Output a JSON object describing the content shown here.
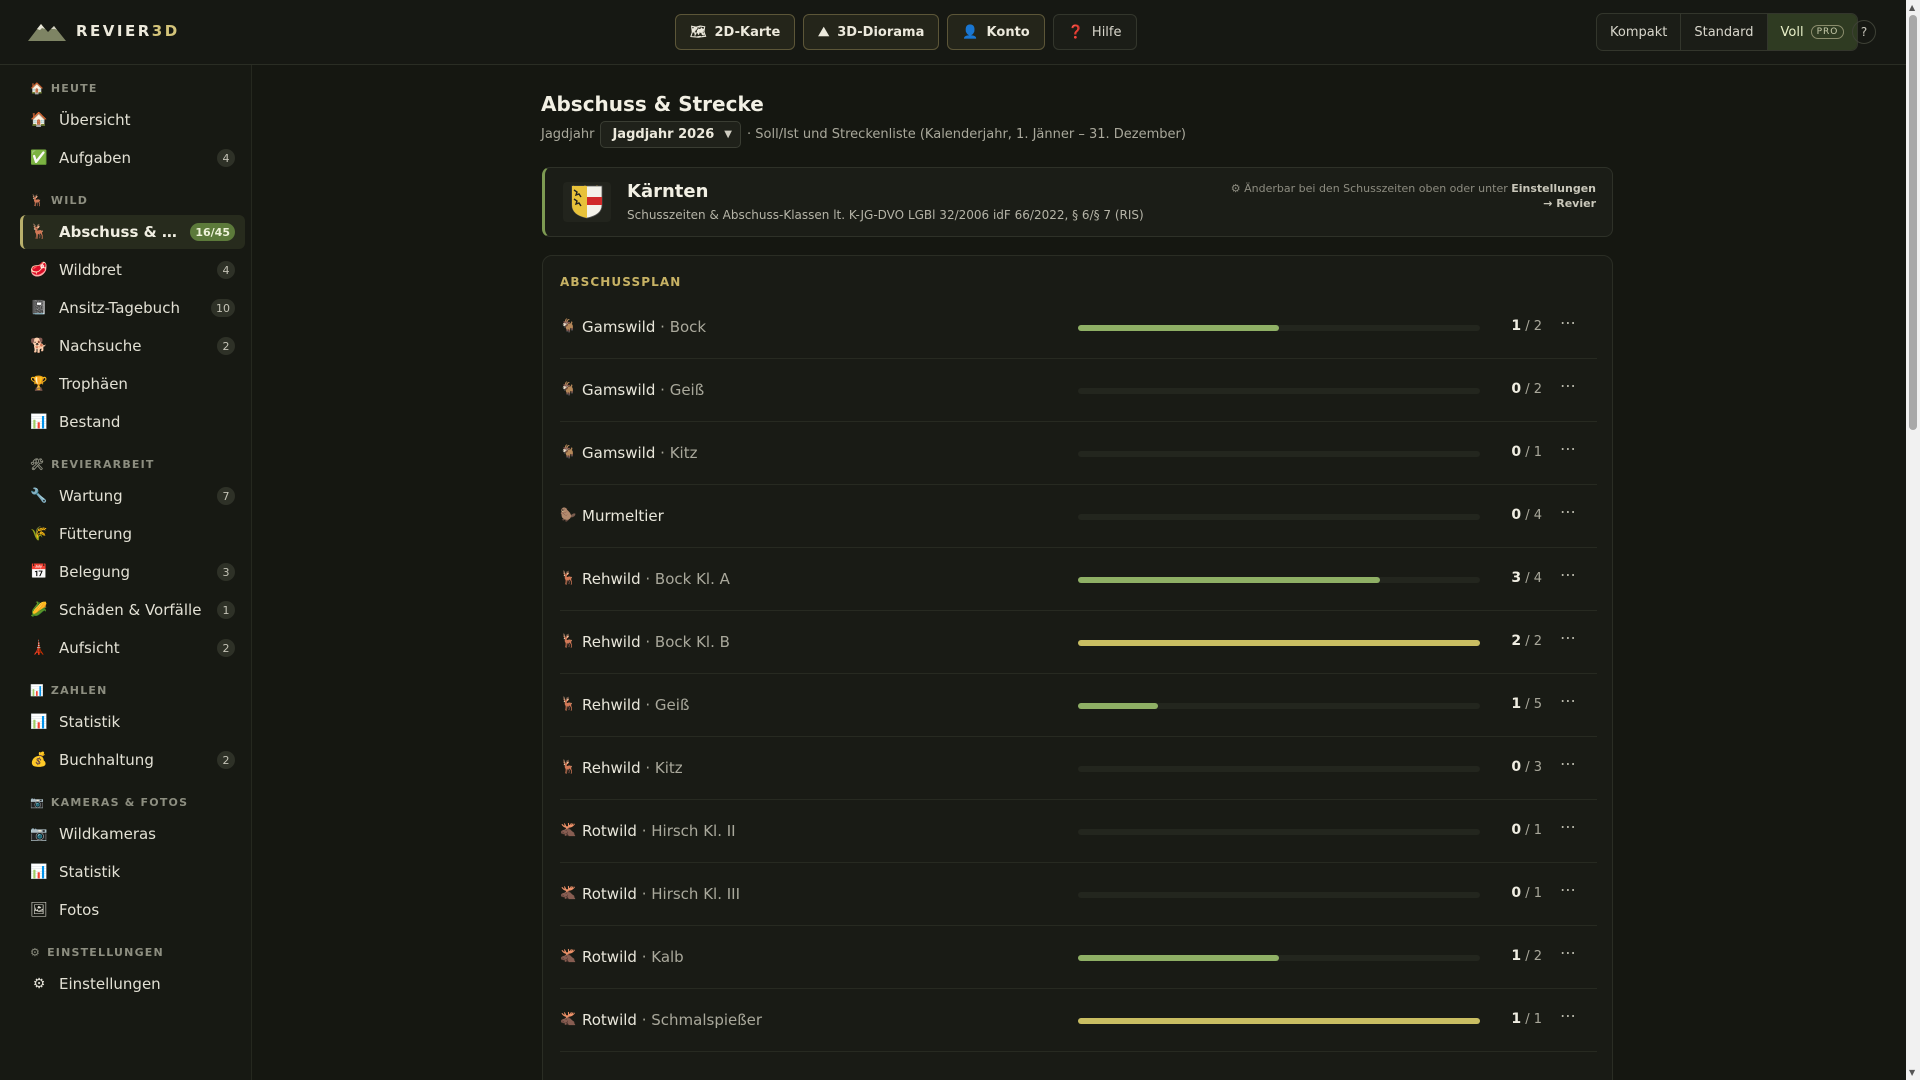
{
  "app": {
    "logo_text": "REVIER",
    "logo_accent": "3D"
  },
  "topnav": [
    {
      "label": "2D-Karte",
      "icon": "map-icon",
      "glyph": "🗺"
    },
    {
      "label": "3D-Diorama",
      "icon": "mountain-icon",
      "glyph": "⛰"
    },
    {
      "label": "Konto",
      "icon": "user-icon",
      "glyph": "👤"
    },
    {
      "label": "Hilfe",
      "icon": "question-icon",
      "glyph": "❓"
    }
  ],
  "view_modes": {
    "compact": "Kompakt",
    "standard": "Standard",
    "full": "Voll",
    "full_badge": "PRO",
    "help": "?"
  },
  "sidebar": {
    "groups": {
      "heute": {
        "title": "HEUTE",
        "icon": "🏠"
      },
      "wild": {
        "title": "WILD",
        "icon": "🦌"
      },
      "revierarbeit": {
        "title": "REVIERARBEIT",
        "icon": "🛠"
      },
      "zahlen": {
        "title": "ZAHLEN",
        "icon": "📊"
      },
      "kameras": {
        "title": "KAMERAS & FOTOS",
        "icon": "📷"
      },
      "einstellungen": {
        "title": "EINSTELLUNGEN",
        "icon": "⚙"
      }
    },
    "items": [
      {
        "label": "Übersicht",
        "icon": "🏠",
        "badge": ""
      },
      {
        "label": "Aufgaben",
        "icon": "✅",
        "badge": "4"
      },
      {
        "label": "Abschuss & Strecke",
        "icon": "🦌",
        "badge": "16/45",
        "active": true
      },
      {
        "label": "Wildbret",
        "icon": "🥩",
        "badge": "4"
      },
      {
        "label": "Ansitz-Tagebuch",
        "icon": "📓",
        "badge": "10"
      },
      {
        "label": "Nachsuche",
        "icon": "🐕",
        "badge": "2"
      },
      {
        "label": "Trophäen",
        "icon": "🏆",
        "badge": ""
      },
      {
        "label": "Bestand",
        "icon": "📊",
        "badge": ""
      },
      {
        "label": "Wartung",
        "icon": "🔧",
        "badge": "7"
      },
      {
        "label": "Fütterung",
        "icon": "🌾",
        "badge": ""
      },
      {
        "label": "Belegung",
        "icon": "📅",
        "badge": "3"
      },
      {
        "label": "Schäden & Vorfälle",
        "icon": "🌽",
        "badge": "1"
      },
      {
        "label": "Aufsicht",
        "icon": "🗼",
        "badge": "2"
      },
      {
        "label": "Statistik",
        "icon": "📊",
        "badge": ""
      },
      {
        "label": "Buchhaltung",
        "icon": "💰",
        "badge": "2"
      },
      {
        "label": "Wildkameras",
        "icon": "📷",
        "badge": ""
      },
      {
        "label": "Statistik",
        "icon": "📊",
        "badge": ""
      },
      {
        "label": "Fotos",
        "icon": "🖼",
        "badge": ""
      },
      {
        "label": "Einstellungen",
        "icon": "⚙",
        "badge": ""
      }
    ]
  },
  "main": {
    "title": "Abschuss & Strecke",
    "year_label": "Jagdjahr",
    "year_value": "Jagdjahr 2026",
    "year_desc": "· Soll/Ist und Streckenliste (Kalenderjahr, 1. Jänner – 31. Dezember)",
    "region": {
      "name": "Kärnten",
      "sub": "Schusszeiten & Abschuss-Klassen lt. K-JG-DVO LGBl 32/2006 idF 66/2022, § 6/§ 7 (RIS)",
      "note_prefix": "⚙ Änderbar bei den Schusszeiten oben oder unter",
      "note_link_1": "Einstellungen",
      "note_link_2": "→ Revier"
    },
    "plan": {
      "title": "ABSCHUSSPLAN",
      "rows": [
        {
          "species": "Gamswild",
          "cls": "· Bock",
          "icon": "🐐",
          "done": 1,
          "target": 2
        },
        {
          "species": "Gamswild",
          "cls": "· Geiß",
          "icon": "🐐",
          "done": 0,
          "target": 2
        },
        {
          "species": "Gamswild",
          "cls": "· Kitz",
          "icon": "🐐",
          "done": 0,
          "target": 1
        },
        {
          "species": "Murmeltier",
          "cls": "",
          "icon": "🦫",
          "done": 0,
          "target": 4
        },
        {
          "species": "Rehwild",
          "cls": "· Bock Kl. A",
          "icon": "🦌",
          "done": 3,
          "target": 4
        },
        {
          "species": "Rehwild",
          "cls": "· Bock Kl. B",
          "icon": "🦌",
          "done": 2,
          "target": 2
        },
        {
          "species": "Rehwild",
          "cls": "· Geiß",
          "icon": "🦌",
          "done": 1,
          "target": 5
        },
        {
          "species": "Rehwild",
          "cls": "· Kitz",
          "icon": "🦌",
          "done": 0,
          "target": 3
        },
        {
          "species": "Rotwild",
          "cls": "· Hirsch Kl. II",
          "icon": "🫎",
          "done": 0,
          "target": 1
        },
        {
          "species": "Rotwild",
          "cls": "· Hirsch Kl. III",
          "icon": "🫎",
          "done": 0,
          "target": 1
        },
        {
          "species": "Rotwild",
          "cls": "· Kalb",
          "icon": "🫎",
          "done": 1,
          "target": 2
        },
        {
          "species": "Rotwild",
          "cls": "· Schmalspießer",
          "icon": "🫎",
          "done": 1,
          "target": 1
        }
      ],
      "more_label": "⋯"
    }
  },
  "colors": {
    "progress": "#8fb065",
    "progress_complete": "#c9be62",
    "accent": "#c7b264"
  }
}
